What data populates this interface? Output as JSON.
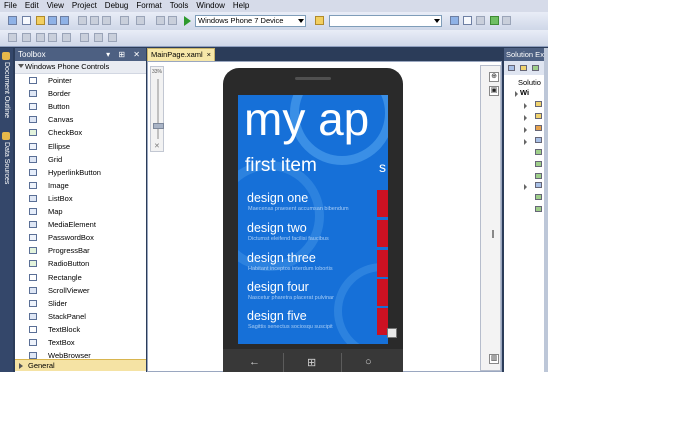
{
  "menu": [
    "File",
    "Edit",
    "View",
    "Project",
    "Debug",
    "Format",
    "Tools",
    "Window",
    "Help"
  ],
  "toolbar": {
    "device_target": "Windows Phone 7 Device",
    "config_combo": ""
  },
  "left_strip": {
    "document_outline": "Document Outline",
    "data_sources": "Data Sources"
  },
  "toolbox": {
    "title": "Toolbox",
    "header_buttons": "▾ ⊞ ✕",
    "group": "Windows Phone Controls",
    "items": [
      {
        "label": "Pointer",
        "icon": "pointer-icon"
      },
      {
        "label": "Border",
        "icon": "border-icon"
      },
      {
        "label": "Button",
        "icon": "button-icon"
      },
      {
        "label": "Canvas",
        "icon": "canvas-icon"
      },
      {
        "label": "CheckBox",
        "icon": "checkbox-icon"
      },
      {
        "label": "Ellipse",
        "icon": "ellipse-icon"
      },
      {
        "label": "Grid",
        "icon": "grid-icon"
      },
      {
        "label": "HyperlinkButton",
        "icon": "hyperlink-icon"
      },
      {
        "label": "Image",
        "icon": "image-icon"
      },
      {
        "label": "ListBox",
        "icon": "listbox-icon"
      },
      {
        "label": "Map",
        "icon": "map-icon"
      },
      {
        "label": "MediaElement",
        "icon": "media-icon"
      },
      {
        "label": "PasswordBox",
        "icon": "password-icon"
      },
      {
        "label": "ProgressBar",
        "icon": "progressbar-icon"
      },
      {
        "label": "RadioButton",
        "icon": "radio-icon"
      },
      {
        "label": "Rectangle",
        "icon": "rectangle-icon"
      },
      {
        "label": "ScrollViewer",
        "icon": "scrollviewer-icon"
      },
      {
        "label": "Slider",
        "icon": "slider-icon"
      },
      {
        "label": "StackPanel",
        "icon": "stackpanel-icon"
      },
      {
        "label": "TextBlock",
        "icon": "textblock-icon"
      },
      {
        "label": "TextBox",
        "icon": "textbox-icon"
      },
      {
        "label": "WebBrowser",
        "icon": "webbrowser-icon"
      }
    ],
    "footer_group": "General"
  },
  "document": {
    "tab_label": "MainPage.xaml",
    "tab_close": "×",
    "zoom_label": "33%",
    "zoom_reset": "✕"
  },
  "phone": {
    "app_title": "my ap",
    "pivot_header": "first item",
    "pivot_next": "s",
    "items": [
      {
        "title": "design one",
        "subtitle": "Maecenas praesent accumsan bibendum"
      },
      {
        "title": "design two",
        "subtitle": "Dictumst eleifend facilisi faucibus"
      },
      {
        "title": "design three",
        "subtitle": "Habitant inceptos interdum lobortis"
      },
      {
        "title": "design four",
        "subtitle": "Nascetur pharetra placerat pulvinar"
      },
      {
        "title": "design five",
        "subtitle": "Sagittis senectus sociosqu suscipit"
      }
    ]
  },
  "solution_explorer": {
    "title": "Solution Explorer",
    "root": "Solutio",
    "project": "Wi"
  },
  "colors": {
    "ide_chrome": "#2b3c59",
    "phone_screen": "#1670d8",
    "accent_bar": "#cc1122",
    "toolbox_footer": "#f5e3a4"
  }
}
